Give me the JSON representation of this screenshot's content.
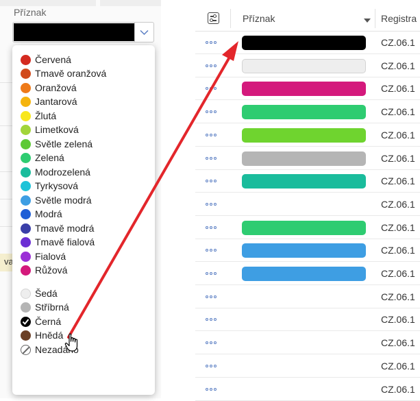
{
  "filter": {
    "label": "Příznak",
    "selected_color": "#000000",
    "dropdown_icon": "chevron-down-icon"
  },
  "left_partial_text": "va",
  "options": [
    {
      "label": "Červená",
      "color": "#d42a20"
    },
    {
      "label": "Tmavě oranžová",
      "color": "#d14a1c"
    },
    {
      "label": "Oranžová",
      "color": "#ee7a19"
    },
    {
      "label": "Jantarová",
      "color": "#f5b40d"
    },
    {
      "label": "Žlutá",
      "color": "#f8e71c"
    },
    {
      "label": "Limetková",
      "color": "#a2d53a"
    },
    {
      "label": "Světle zelená",
      "color": "#5ec935"
    },
    {
      "label": "Zelená",
      "color": "#2ecc71"
    },
    {
      "label": "Modrozelená",
      "color": "#1abc9c"
    },
    {
      "label": "Tyrkysová",
      "color": "#1ec3d8"
    },
    {
      "label": "Světle modrá",
      "color": "#3e9ee3"
    },
    {
      "label": "Modrá",
      "color": "#1f5fd6"
    },
    {
      "label": "Tmavě modrá",
      "color": "#3a3fa8"
    },
    {
      "label": "Tmavě fialová",
      "color": "#6c2fd4"
    },
    {
      "label": "Fialová",
      "color": "#9b2fd6"
    },
    {
      "label": "Růžová",
      "color": "#d4197c"
    },
    {
      "label": "Šedá",
      "color": "#eeeeee"
    },
    {
      "label": "Stříbrná",
      "color": "#b5b5b5"
    },
    {
      "label": "Černá",
      "color": "#000000",
      "checked": true
    },
    {
      "label": "Hnědá",
      "color": "#6b4026"
    },
    {
      "label": "Nezadáno",
      "color": "none"
    }
  ],
  "grid": {
    "columns": [
      "Příznak",
      "Registra"
    ],
    "column_settings_icon": "column-settings-icon",
    "rows": [
      {
        "flag": "#000000",
        "reg": "CZ.06.1"
      },
      {
        "flag": "#eeeeee",
        "reg": "CZ.06.1"
      },
      {
        "flag": "#d4197c",
        "reg": "CZ.06.1"
      },
      {
        "flag": "#2ecc71",
        "reg": "CZ.06.1"
      },
      {
        "flag": "#6fd42f",
        "reg": "CZ.06.1"
      },
      {
        "flag": "#b5b5b5",
        "reg": "CZ.06.1"
      },
      {
        "flag": "#1abc9c",
        "reg": "CZ.06.1"
      },
      {
        "flag": null,
        "reg": "CZ.06.1"
      },
      {
        "flag": "#2ecc71",
        "reg": "CZ.06.1"
      },
      {
        "flag": "#3e9ee3",
        "reg": "CZ.06.1"
      },
      {
        "flag": "#3e9ee3",
        "reg": "CZ.06.1"
      },
      {
        "flag": null,
        "reg": "CZ.06.1"
      },
      {
        "flag": null,
        "reg": "CZ.06.1"
      },
      {
        "flag": null,
        "reg": "CZ.06.1"
      },
      {
        "flag": null,
        "reg": "CZ.06.1"
      },
      {
        "flag": null,
        "reg": "CZ.06.1"
      }
    ]
  },
  "annotation": {
    "arrow_color": "#e3262b",
    "cursor_icon": "hand-pointer-icon"
  }
}
